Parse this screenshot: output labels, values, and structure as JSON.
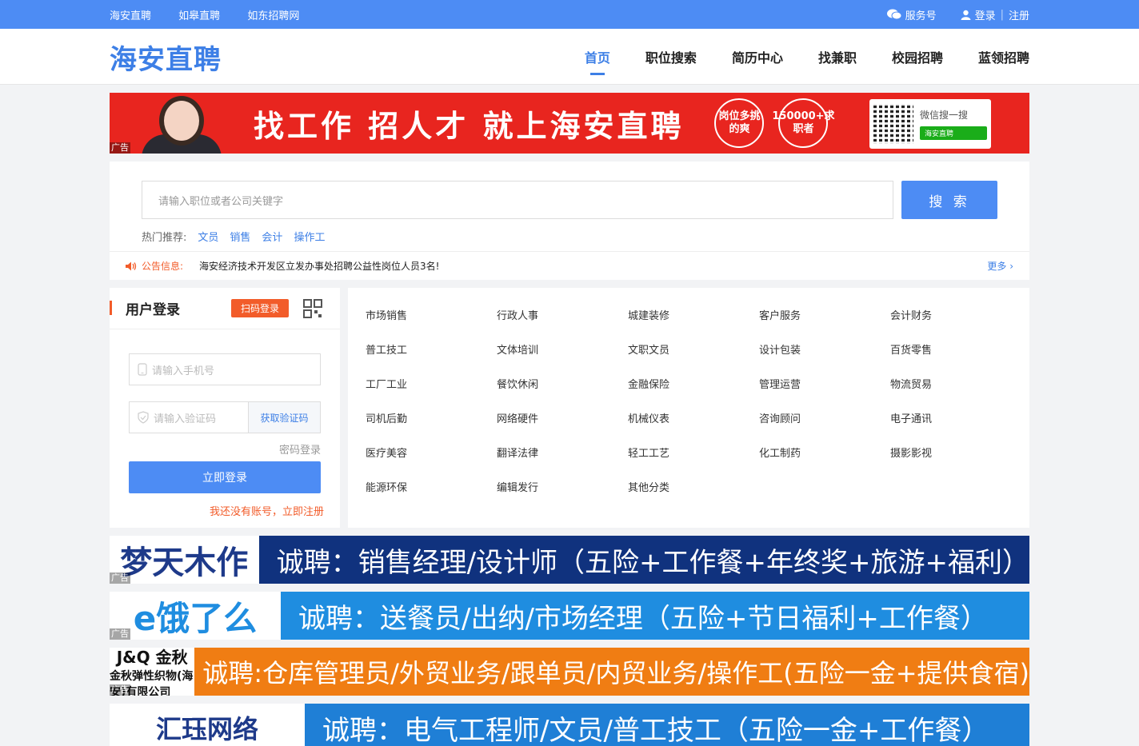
{
  "topbar": {
    "links": [
      "海安直聘",
      "如皋直聘",
      "如东招聘网"
    ],
    "service": "服务号",
    "login": "登录",
    "register": "注册"
  },
  "header": {
    "logo": "海安直聘",
    "nav": [
      "首页",
      "职位搜索",
      "简历中心",
      "找兼职",
      "校园招聘",
      "蓝领招聘"
    ],
    "active_index": 0
  },
  "banner": {
    "slogan": "找工作 招人才 就上海安直聘",
    "circle1": "岗位多挑的爽",
    "circle2": "150000+求职者",
    "wechat_text": "微信搜一搜",
    "wechat_btn": "海安直聘",
    "ad_tag": "广告"
  },
  "search": {
    "placeholder": "请输入职位或者公司关键字",
    "button": "搜 索",
    "hot_label": "热门推荐:",
    "hot": [
      "文员",
      "销售",
      "会计",
      "操作工"
    ]
  },
  "notice": {
    "label": "公告信息:",
    "message": "海安经济技术开发区立发办事处招聘公益性岗位人员3名!",
    "more": "更多 ›"
  },
  "login": {
    "title": "用户登录",
    "scan": "扫码登录",
    "phone_placeholder": "请输入手机号",
    "code_placeholder": "请输入验证码",
    "get_code": "获取验证码",
    "pwd_login": "密码登录",
    "submit": "立即登录",
    "register": "我还没有账号，立即注册"
  },
  "categories": [
    "市场销售",
    "行政人事",
    "城建装修",
    "客户服务",
    "会计财务",
    "普工技工",
    "文体培训",
    "文职文员",
    "设计包装",
    "百货零售",
    "工厂工业",
    "餐饮休闲",
    "金融保险",
    "管理运营",
    "物流贸易",
    "司机后勤",
    "网络硬件",
    "机械仪表",
    "咨询顾问",
    "电子通讯",
    "医疗美容",
    "翻译法律",
    "轻工工艺",
    "化工制药",
    "摄影影视",
    "能源环保",
    "编辑发行",
    "其他分类"
  ],
  "ads": [
    {
      "brand": "梦天木作",
      "text": "诚聘：销售经理/设计师（五险+工作餐+年终奖+旅游+福利）",
      "tag": "广告"
    },
    {
      "brand": "e饿了么",
      "text": "诚聘：送餐员/出纳/市场经理（五险+节日福利+工作餐）",
      "tag": "广告"
    },
    {
      "brand": "J&Q 金秋",
      "brand_sub": "金秋弹性织物(海安)有限公司",
      "text": "诚聘:仓库管理员/外贸业务/跟单员/内贸业务/操作工(五险一金+提供食宿)",
      "tag": "广告"
    },
    {
      "brand": "汇珏网络",
      "text": "诚聘：电气工程师/文员/普工技工（五险一金+工作餐）",
      "tag": ""
    }
  ],
  "colors": {
    "primary": "#4d8cf4",
    "accent": "#f25c2a",
    "banner_red": "#e8251f"
  }
}
